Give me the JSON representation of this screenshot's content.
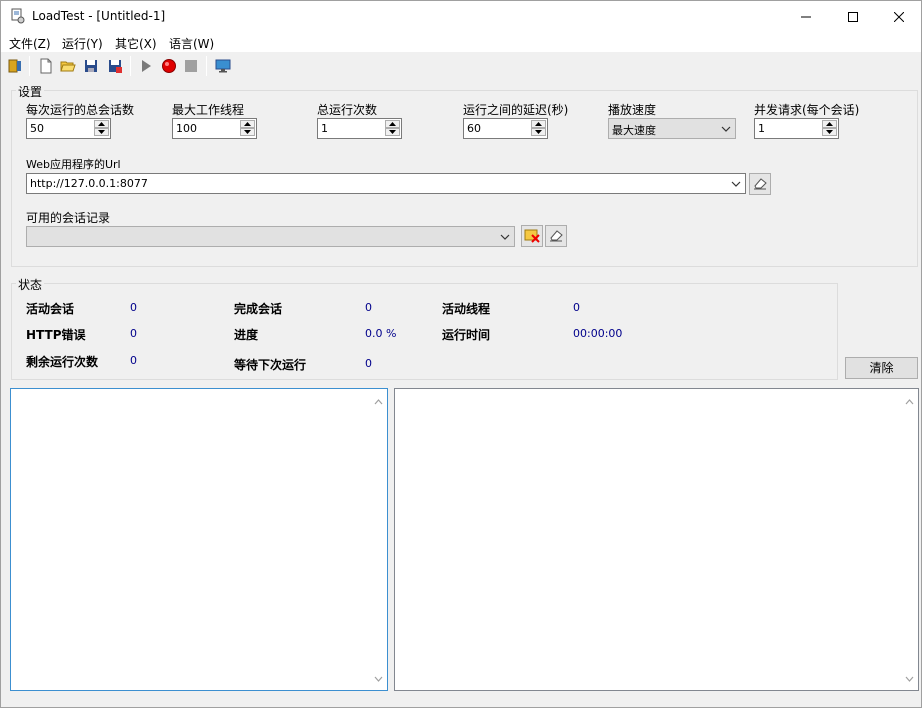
{
  "window": {
    "title": "LoadTest - [Untitled-1]"
  },
  "menu": [
    {
      "label": "文件(Z)"
    },
    {
      "label": "运行(Y)"
    },
    {
      "label": "其它(X)"
    },
    {
      "label": "语言(W)"
    }
  ],
  "toolbar": {
    "icons": [
      "exit-icon",
      "new-file-icon",
      "open-folder-icon",
      "save-icon",
      "save-as-icon",
      "play-icon",
      "record-icon",
      "stop-icon",
      "monitor-icon"
    ]
  },
  "settings": {
    "group_label": "设置",
    "sessions_per_run": {
      "label": "每次运行的总会话数",
      "value": "50"
    },
    "max_threads": {
      "label": "最大工作线程",
      "value": "100"
    },
    "total_runs": {
      "label": "总运行次数",
      "value": "1"
    },
    "delay": {
      "label": "运行之间的延迟(秒)",
      "value": "60"
    },
    "playback_speed": {
      "label": "播放速度",
      "value": "最大速度"
    },
    "concurrent": {
      "label": "并发请求(每个会话)",
      "value": "1"
    },
    "url": {
      "label": "Web应用程序的Url",
      "value": "http://127.0.0.1:8077"
    },
    "sessions": {
      "label": "可用的会话记录",
      "value": ""
    }
  },
  "status": {
    "group_label": "状态",
    "active_sessions": {
      "label": "活动会话",
      "value": "0"
    },
    "completed_sessions": {
      "label": "完成会话",
      "value": "0"
    },
    "active_threads": {
      "label": "活动线程",
      "value": "0"
    },
    "http_errors": {
      "label": "HTTP错误",
      "value": "0"
    },
    "progress": {
      "label": "进度",
      "value": "0.0 %"
    },
    "run_time": {
      "label": "运行时间",
      "value": "00:00:00"
    },
    "remaining_runs": {
      "label": "剩余运行次数",
      "value": "0"
    },
    "waiting_next": {
      "label": "等待下次运行",
      "value": "0"
    }
  },
  "clear_button": "清除",
  "colors": {
    "value_text": "#00008b",
    "pane_border": "#828790",
    "background": "#f0f0f0"
  }
}
